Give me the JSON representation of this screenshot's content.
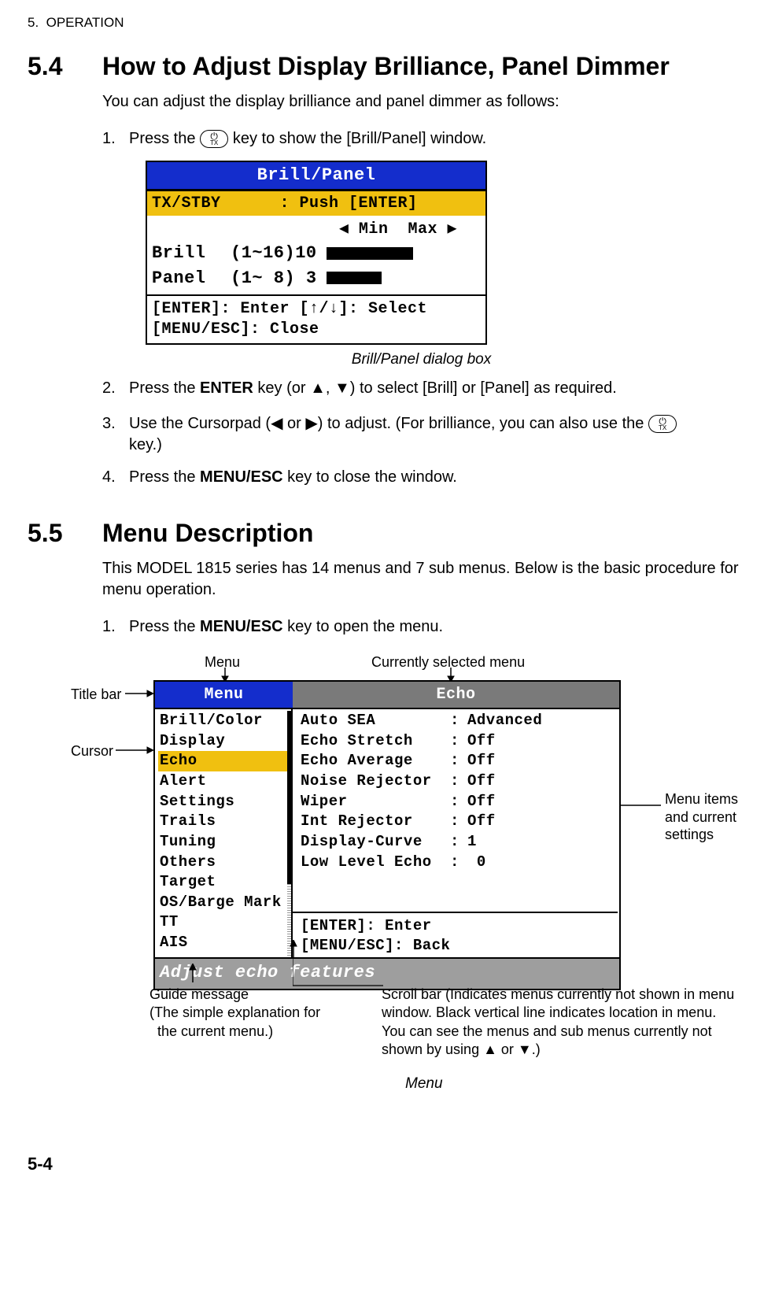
{
  "running_head": "5.  OPERATION",
  "section54": {
    "num": "5.4",
    "title": "How to Adjust Display Brilliance, Panel Dimmer",
    "intro": "You can adjust the display brilliance and panel dimmer as follows:",
    "steps": [
      {
        "n": "1.",
        "pre": "Press the ",
        "post": " key to show the [Brill/Panel] window."
      }
    ],
    "brill": {
      "title": "Brill/Panel",
      "row_txstby": "TX/STBY      : Push [ENTER]",
      "minmax": "◀ Min  Max ▶",
      "row_brill_label": "Brill",
      "row_brill_range": "(1~16)10",
      "row_panel_label": "Panel",
      "row_panel_range": "(1~ 8) 3",
      "footer1": "[ENTER]: Enter [↑/↓]: Select",
      "footer2": "[MENU/ESC]: Close"
    },
    "caption": "Brill/Panel dialog box",
    "step2_pre": "Press the ",
    "step2_bold": "ENTER",
    "step2_post": " key (or ▲, ▼) to select [Brill] or [Panel] as required.",
    "step3": "Use the Cursorpad (◀ or ▶) to adjust. (For brilliance, you can also use the ",
    "step3_post": " key.)",
    "step4_pre": "Press the ",
    "step4_bold": "MENU/ESC",
    "step4_post": " key to close the window."
  },
  "section55": {
    "num": "5.5",
    "title": "Menu Description",
    "intro": "This MODEL 1815 series has 14 menus and 7 sub menus. Below is the basic procedure for menu operation.",
    "step1_pre": "Press the ",
    "step1_bold": "MENU/ESC",
    "step1_post": " key to open the menu.",
    "ann_menu": "Menu",
    "ann_curr": "Currently selected menu",
    "ann_titlebar": "Title bar",
    "ann_cursor": "Cursor",
    "ann_items": "Menu items and current settings",
    "ann_guide": "Guide message\n(The simple explanation for\n  the current menu.)",
    "ann_scroll": "Scroll bar (Indicates menus currently not shown in menu window. Black vertical line indicates location in menu.\nYou can see the menus and sub menus currently not shown by using ▲ or ▼.)",
    "menu_window": {
      "left_title": "Menu",
      "right_title": "Echo",
      "left_items": [
        "Brill/Color",
        "Display",
        "Echo",
        "Alert Settings",
        "Trails",
        "Tuning",
        "Others",
        "Target",
        "OS/Barge Mark",
        "TT",
        "AIS"
      ],
      "selected_index": 2,
      "right_items": [
        {
          "label": "Auto SEA",
          "value": "Advanced"
        },
        {
          "label": "Echo Stretch",
          "value": "Off"
        },
        {
          "label": "Echo Average",
          "value": "Off"
        },
        {
          "label": "Noise Rejector",
          "value": "Off"
        },
        {
          "label": "Wiper",
          "value": "Off"
        },
        {
          "label": "Int Rejector",
          "value": "Off"
        },
        {
          "label": "Display-Curve",
          "value": "1"
        },
        {
          "label": "Low Level Echo",
          "value": " 0"
        }
      ],
      "hint1": "[ENTER]: Enter",
      "hint2": "[MENU/ESC]: Back",
      "guide": "Adjust echo features"
    },
    "caption": "Menu"
  },
  "page_num": "5-4"
}
